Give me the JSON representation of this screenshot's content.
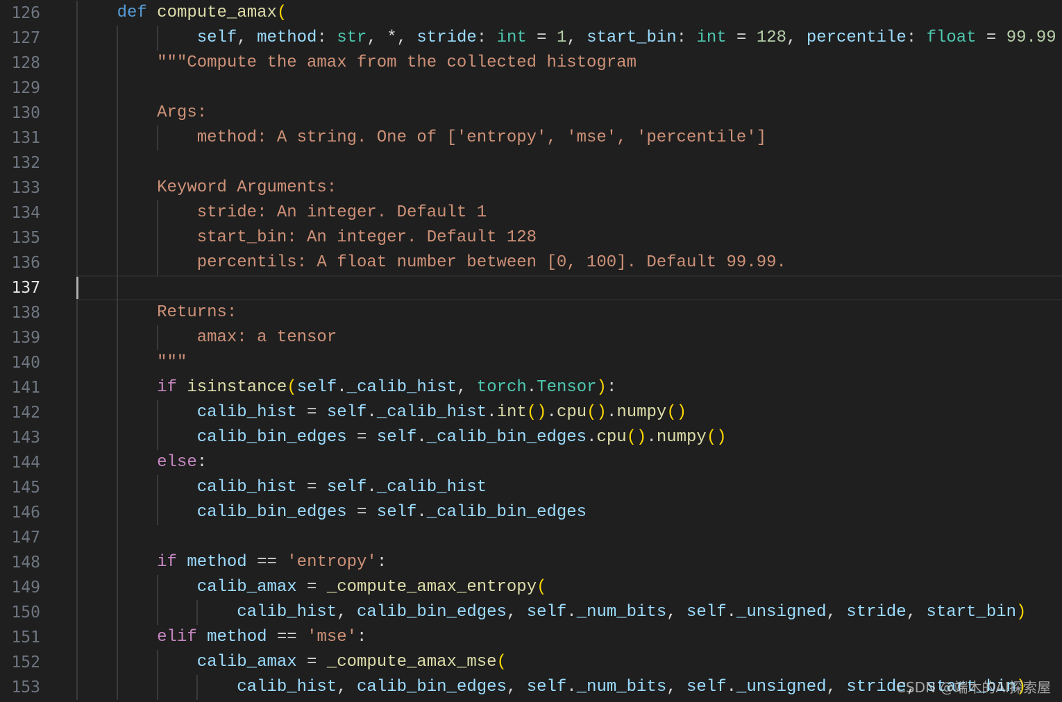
{
  "editor": {
    "active_line": 137,
    "colors": {
      "background": "#1f1f1f",
      "keyword": "#569cd6",
      "control": "#c586c0",
      "function": "#dcdcaa",
      "variable": "#9cdcfe",
      "type": "#4ec9b0",
      "number": "#b5cea8",
      "string": "#ce9178",
      "bracket": "#ffd700"
    },
    "lines": [
      {
        "n": "126",
        "t": [
          [
            "    ",
            ""
          ],
          [
            "def",
            "kw"
          ],
          [
            " ",
            ""
          ],
          [
            "compute_amax",
            "fn"
          ],
          [
            "(",
            "br"
          ]
        ]
      },
      {
        "n": "127",
        "t": [
          [
            "            ",
            ""
          ],
          [
            "self",
            "var"
          ],
          [
            ", ",
            "op"
          ],
          [
            "method",
            "var"
          ],
          [
            ": ",
            "op"
          ],
          [
            "str",
            "type"
          ],
          [
            ", *, ",
            "op"
          ],
          [
            "stride",
            "var"
          ],
          [
            ": ",
            "op"
          ],
          [
            "int",
            "type"
          ],
          [
            " = ",
            "op"
          ],
          [
            "1",
            "num"
          ],
          [
            ", ",
            "op"
          ],
          [
            "start_bin",
            "var"
          ],
          [
            ": ",
            "op"
          ],
          [
            "int",
            "type"
          ],
          [
            " = ",
            "op"
          ],
          [
            "128",
            "num"
          ],
          [
            ", ",
            "op"
          ],
          [
            "percentile",
            "var"
          ],
          [
            ": ",
            "op"
          ],
          [
            "float",
            "type"
          ],
          [
            " = ",
            "op"
          ],
          [
            "99.99",
            "num"
          ]
        ]
      },
      {
        "n": "128",
        "t": [
          [
            "        ",
            ""
          ],
          [
            "\"\"\"Compute the amax from the collected histogram",
            "str"
          ]
        ]
      },
      {
        "n": "129",
        "t": []
      },
      {
        "n": "130",
        "t": [
          [
            "        ",
            ""
          ],
          [
            "Args:",
            "str"
          ]
        ]
      },
      {
        "n": "131",
        "t": [
          [
            "            ",
            ""
          ],
          [
            "method: A string. One of ['entropy', 'mse', 'percentile']",
            "str"
          ]
        ]
      },
      {
        "n": "132",
        "t": []
      },
      {
        "n": "133",
        "t": [
          [
            "        ",
            ""
          ],
          [
            "Keyword Arguments:",
            "str"
          ]
        ]
      },
      {
        "n": "134",
        "t": [
          [
            "            ",
            ""
          ],
          [
            "stride: An integer. Default 1",
            "str"
          ]
        ]
      },
      {
        "n": "135",
        "t": [
          [
            "            ",
            ""
          ],
          [
            "start_bin: An integer. Default 128",
            "str"
          ]
        ]
      },
      {
        "n": "136",
        "t": [
          [
            "            ",
            ""
          ],
          [
            "percentils: A float number between [0, 100]. Default 99.99.",
            "str"
          ]
        ]
      },
      {
        "n": "137",
        "t": []
      },
      {
        "n": "138",
        "t": [
          [
            "        ",
            ""
          ],
          [
            "Returns:",
            "str"
          ]
        ]
      },
      {
        "n": "139",
        "t": [
          [
            "            ",
            ""
          ],
          [
            "amax: a tensor",
            "str"
          ]
        ]
      },
      {
        "n": "140",
        "t": [
          [
            "        ",
            ""
          ],
          [
            "\"\"\"",
            "str"
          ]
        ]
      },
      {
        "n": "141",
        "t": [
          [
            "        ",
            ""
          ],
          [
            "if",
            "ctrl"
          ],
          [
            " ",
            ""
          ],
          [
            "isinstance",
            "fn"
          ],
          [
            "(",
            "br"
          ],
          [
            "self",
            "var"
          ],
          [
            ".",
            "op"
          ],
          [
            "_calib_hist",
            "var"
          ],
          [
            ", ",
            "op"
          ],
          [
            "torch",
            "type"
          ],
          [
            ".",
            "op"
          ],
          [
            "Tensor",
            "type"
          ],
          [
            ")",
            "br"
          ],
          [
            ":",
            "op"
          ]
        ]
      },
      {
        "n": "142",
        "t": [
          [
            "            ",
            ""
          ],
          [
            "calib_hist",
            "var"
          ],
          [
            " = ",
            "op"
          ],
          [
            "self",
            "var"
          ],
          [
            ".",
            "op"
          ],
          [
            "_calib_hist",
            "var"
          ],
          [
            ".",
            "op"
          ],
          [
            "int",
            "fn"
          ],
          [
            "()",
            "br"
          ],
          [
            ".",
            "op"
          ],
          [
            "cpu",
            "fn"
          ],
          [
            "()",
            "br"
          ],
          [
            ".",
            "op"
          ],
          [
            "numpy",
            "fn"
          ],
          [
            "()",
            "br"
          ]
        ]
      },
      {
        "n": "143",
        "t": [
          [
            "            ",
            ""
          ],
          [
            "calib_bin_edges",
            "var"
          ],
          [
            " = ",
            "op"
          ],
          [
            "self",
            "var"
          ],
          [
            ".",
            "op"
          ],
          [
            "_calib_bin_edges",
            "var"
          ],
          [
            ".",
            "op"
          ],
          [
            "cpu",
            "fn"
          ],
          [
            "()",
            "br"
          ],
          [
            ".",
            "op"
          ],
          [
            "numpy",
            "fn"
          ],
          [
            "()",
            "br"
          ]
        ]
      },
      {
        "n": "144",
        "t": [
          [
            "        ",
            ""
          ],
          [
            "else",
            "ctrl"
          ],
          [
            ":",
            "op"
          ]
        ]
      },
      {
        "n": "145",
        "t": [
          [
            "            ",
            ""
          ],
          [
            "calib_hist",
            "var"
          ],
          [
            " = ",
            "op"
          ],
          [
            "self",
            "var"
          ],
          [
            ".",
            "op"
          ],
          [
            "_calib_hist",
            "var"
          ]
        ]
      },
      {
        "n": "146",
        "t": [
          [
            "            ",
            ""
          ],
          [
            "calib_bin_edges",
            "var"
          ],
          [
            " = ",
            "op"
          ],
          [
            "self",
            "var"
          ],
          [
            ".",
            "op"
          ],
          [
            "_calib_bin_edges",
            "var"
          ]
        ]
      },
      {
        "n": "147",
        "t": []
      },
      {
        "n": "148",
        "t": [
          [
            "        ",
            ""
          ],
          [
            "if",
            "ctrl"
          ],
          [
            " ",
            ""
          ],
          [
            "method",
            "var"
          ],
          [
            " == ",
            "op"
          ],
          [
            "'entropy'",
            "str"
          ],
          [
            ":",
            "op"
          ]
        ]
      },
      {
        "n": "149",
        "t": [
          [
            "            ",
            ""
          ],
          [
            "calib_amax",
            "var"
          ],
          [
            " = ",
            "op"
          ],
          [
            "_compute_amax_entropy",
            "fn"
          ],
          [
            "(",
            "br"
          ]
        ]
      },
      {
        "n": "150",
        "t": [
          [
            "                ",
            ""
          ],
          [
            "calib_hist",
            "var"
          ],
          [
            ", ",
            "op"
          ],
          [
            "calib_bin_edges",
            "var"
          ],
          [
            ", ",
            "op"
          ],
          [
            "self",
            "var"
          ],
          [
            ".",
            "op"
          ],
          [
            "_num_bits",
            "var"
          ],
          [
            ", ",
            "op"
          ],
          [
            "self",
            "var"
          ],
          [
            ".",
            "op"
          ],
          [
            "_unsigned",
            "var"
          ],
          [
            ", ",
            "op"
          ],
          [
            "stride",
            "var"
          ],
          [
            ", ",
            "op"
          ],
          [
            "start_bin",
            "var"
          ],
          [
            ")",
            "br"
          ]
        ]
      },
      {
        "n": "151",
        "t": [
          [
            "        ",
            ""
          ],
          [
            "elif",
            "ctrl"
          ],
          [
            " ",
            ""
          ],
          [
            "method",
            "var"
          ],
          [
            " == ",
            "op"
          ],
          [
            "'mse'",
            "str"
          ],
          [
            ":",
            "op"
          ]
        ]
      },
      {
        "n": "152",
        "t": [
          [
            "            ",
            ""
          ],
          [
            "calib_amax",
            "var"
          ],
          [
            " = ",
            "op"
          ],
          [
            "_compute_amax_mse",
            "fn"
          ],
          [
            "(",
            "br"
          ]
        ]
      },
      {
        "n": "153",
        "t": [
          [
            "                ",
            ""
          ],
          [
            "calib_hist",
            "var"
          ],
          [
            ", ",
            "op"
          ],
          [
            "calib_bin_edges",
            "var"
          ],
          [
            ", ",
            "op"
          ],
          [
            "self",
            "var"
          ],
          [
            ".",
            "op"
          ],
          [
            "_num_bits",
            "var"
          ],
          [
            ", ",
            "op"
          ],
          [
            "self",
            "var"
          ],
          [
            ".",
            "op"
          ],
          [
            "_unsigned",
            "var"
          ],
          [
            ", ",
            "op"
          ],
          [
            "stride",
            "var"
          ],
          [
            ", ",
            "op"
          ],
          [
            "start_bin",
            "var"
          ],
          [
            ")",
            "br"
          ]
        ]
      }
    ]
  },
  "watermark": "CSDN @端木的AI探索屋"
}
